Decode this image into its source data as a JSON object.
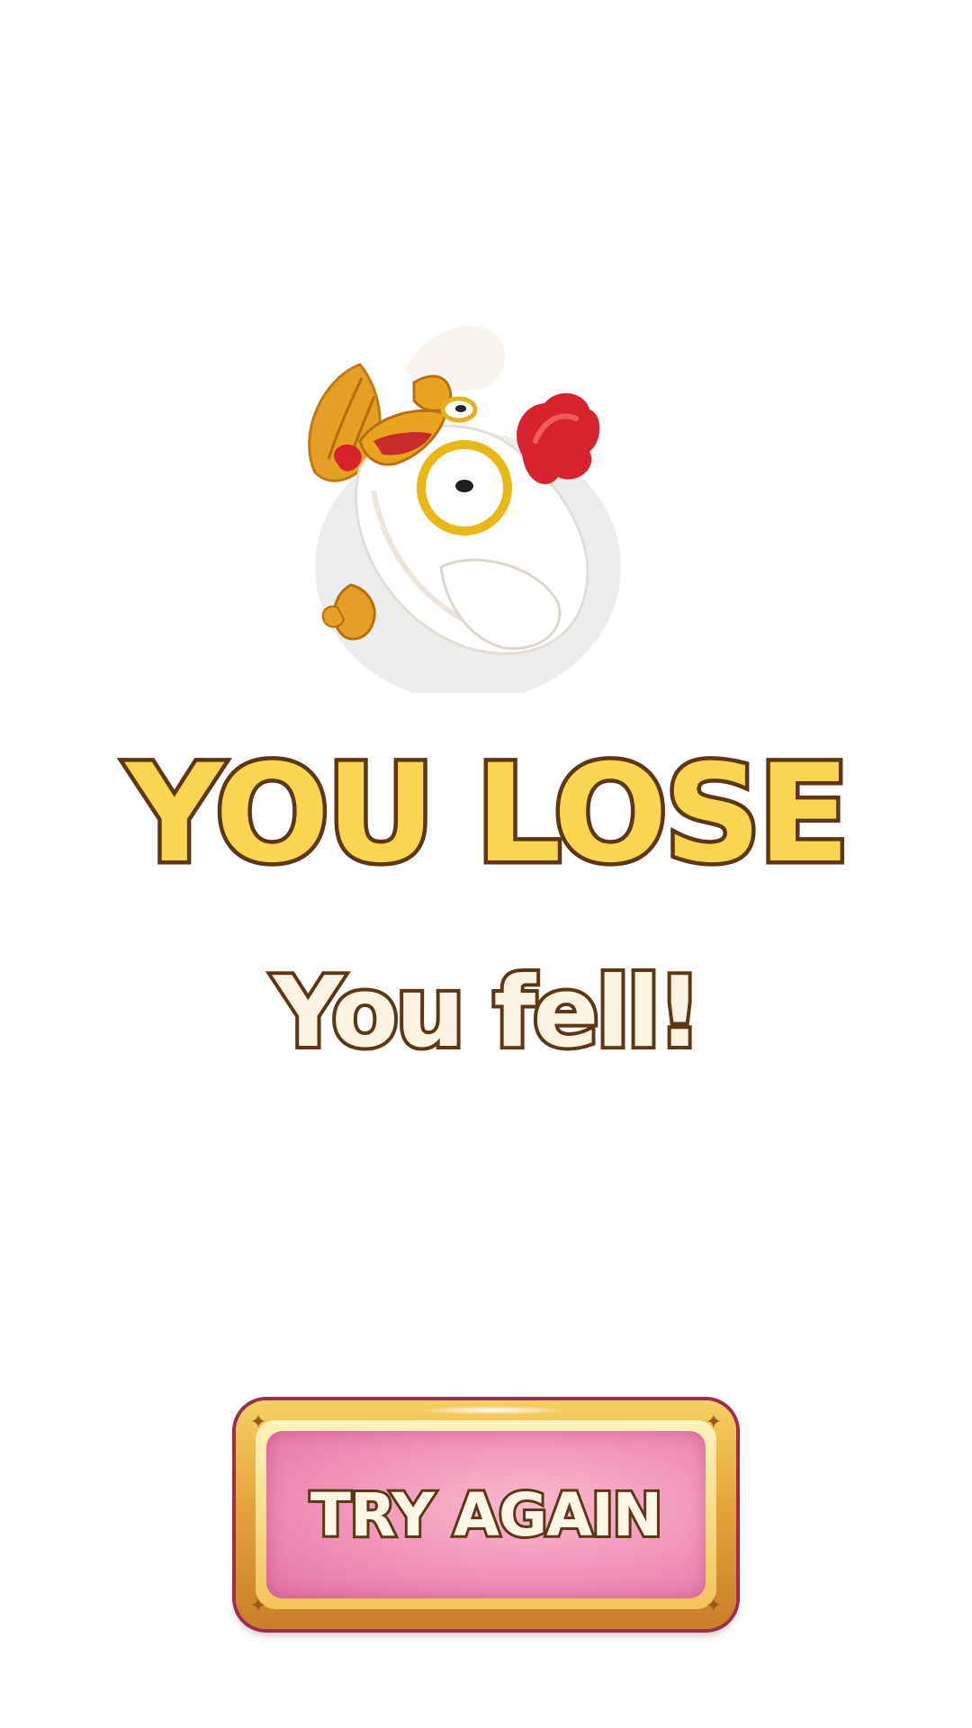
{
  "screen": {
    "title": "YOU LOSE",
    "message": "You fell!"
  },
  "character": {
    "icon": "chicken-falling-icon"
  },
  "actions": {
    "try_again_label": "TRY AGAIN"
  },
  "colors": {
    "title_fill": "#fbd54f",
    "text_outline": "#5c3615",
    "subtitle_fill": "#fdf3e3",
    "button_face": "#f291b8",
    "button_frame": "#e6a43c"
  }
}
